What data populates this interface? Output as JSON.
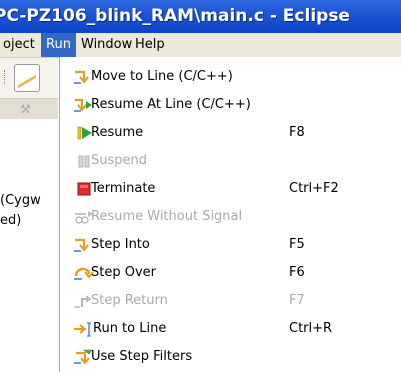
{
  "window": {
    "title": "PC-PZ106_blink_RAM\\main.c - Eclipse"
  },
  "menubar": {
    "items": [
      {
        "label": "oject"
      },
      {
        "label": "Run"
      },
      {
        "label": "Window"
      },
      {
        "label": "Help"
      }
    ]
  },
  "background": {
    "text_lines": [
      "(Cygw",
      "ed)"
    ]
  },
  "run_menu": {
    "items": [
      {
        "label": "Move to Line (C/C++)",
        "accel": "",
        "enabled": true,
        "icon": "move-to-line-icon"
      },
      {
        "label": "Resume At Line (C/C++)",
        "accel": "",
        "enabled": true,
        "icon": "resume-at-line-icon"
      },
      {
        "label": "Resume",
        "accel": "F8",
        "enabled": true,
        "icon": "resume-icon"
      },
      {
        "label": "Suspend",
        "accel": "",
        "enabled": false,
        "icon": "suspend-icon"
      },
      {
        "label": "Terminate",
        "accel": "Ctrl+F2",
        "enabled": true,
        "icon": "terminate-icon"
      },
      {
        "label": "Resume Without Signal",
        "accel": "",
        "enabled": false,
        "icon": "resume-without-signal-icon"
      },
      {
        "label": "Step Into",
        "accel": "F5",
        "enabled": true,
        "icon": "step-into-icon"
      },
      {
        "label": "Step Over",
        "accel": "F6",
        "enabled": true,
        "icon": "step-over-icon"
      },
      {
        "label": "Step Return",
        "accel": "F7",
        "enabled": false,
        "icon": "step-return-icon"
      },
      {
        "label": "Run to Line",
        "accel": "Ctrl+R",
        "enabled": true,
        "icon": "run-to-line-icon"
      },
      {
        "label": "Use Step Filters",
        "accel": "",
        "enabled": true,
        "icon": "use-step-filters-icon"
      }
    ]
  },
  "colors": {
    "titlebar": "#0b45c8",
    "menu_highlight": "#316ac5",
    "menubar_bg": "#ece9d8",
    "disabled_text": "#a9a9a9",
    "terminate_red": "#e22c2c",
    "resume_green": "#2fa33a",
    "step_arrow_gold": "#e0a020"
  }
}
